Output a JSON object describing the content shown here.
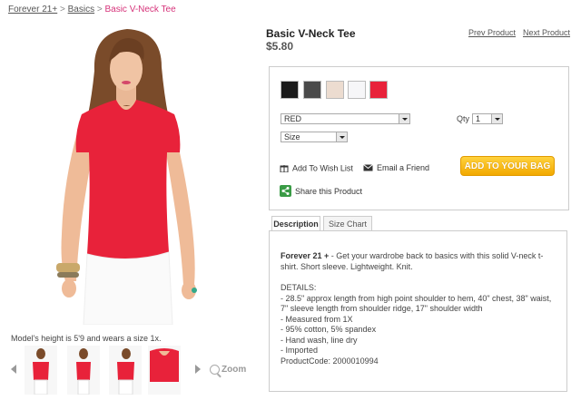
{
  "breadcrumb": {
    "items": [
      "Forever 21+",
      "Basics"
    ],
    "separator": ">",
    "current": "Basic V-Neck Tee"
  },
  "product": {
    "title": "Basic V-Neck Tee",
    "price": "$5.80"
  },
  "nav": {
    "prev": "Prev Product",
    "next": "Next Product"
  },
  "swatches": [
    {
      "name": "black",
      "color": "#1a1a1a"
    },
    {
      "name": "charcoal",
      "color": "#4a4a4a"
    },
    {
      "name": "beige",
      "color": "#ecdcd0"
    },
    {
      "name": "white",
      "color": "#f6f6f8"
    },
    {
      "name": "red",
      "color": "#e8223a"
    }
  ],
  "options": {
    "color_value": "RED",
    "size_value": "Size",
    "qty_label": "Qty",
    "qty_value": "1"
  },
  "actions": {
    "wishlist": "Add To Wish List",
    "email": "Email a Friend",
    "share": "Share this Product",
    "add_to_bag": "ADD TO YOUR BAG"
  },
  "tabs": [
    "Description",
    "Size Chart"
  ],
  "description": {
    "brand": "Forever 21 +",
    "summary": " - Get your wardrobe back to basics with this solid V-neck t-shirt. Short sleeve. Lightweight. Knit.",
    "details_heading": "DETAILS:",
    "details": [
      "- 28.5\" approx length from high point shoulder to hem, 40\" chest, 38\" waist, 7\" sleeve length from shoulder ridge, 17\" shoulder width",
      "- Measured from 1X",
      "- 95% cotton, 5% spandex",
      "- Hand wash, line dry",
      "- Imported",
      "ProductCode: 2000010994"
    ]
  },
  "gallery": {
    "caption": "Model's height is 5'9 and wears a size 1x.",
    "zoom_label": "Zoom",
    "thumbnail_count": 4
  },
  "colors": {
    "accent_pink": "#d6337a",
    "tee_red": "#e8223a",
    "button_orange": "#f2a900"
  }
}
